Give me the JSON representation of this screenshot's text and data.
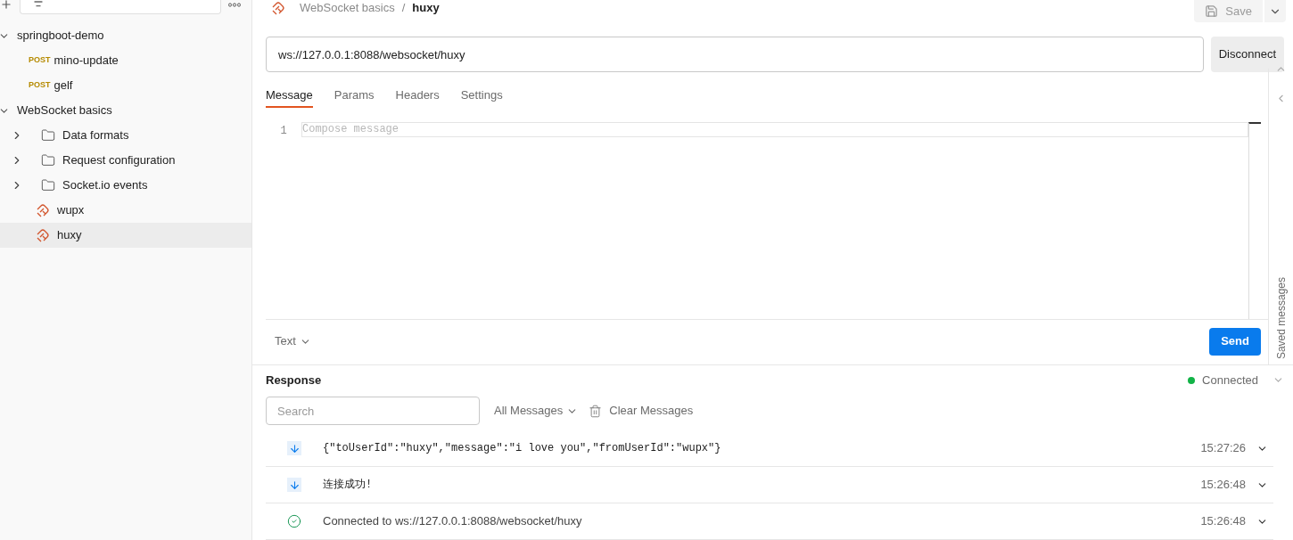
{
  "sidebar": {
    "items": [
      {
        "kind": "collection",
        "label": "springboot-demo",
        "expanded": true,
        "children": [
          {
            "kind": "request",
            "method": "POST",
            "label": "mino-update",
            "selected": false
          },
          {
            "kind": "request",
            "method": "POST",
            "label": "gelf",
            "selected": false
          }
        ]
      },
      {
        "kind": "collection",
        "label": "WebSocket basics",
        "expanded": true,
        "children": [
          {
            "kind": "folder",
            "label": "Data formats",
            "expanded": false
          },
          {
            "kind": "folder",
            "label": "Request configuration",
            "expanded": false
          },
          {
            "kind": "folder",
            "label": "Socket.io events",
            "expanded": false
          },
          {
            "kind": "websocket",
            "label": "wupx",
            "selected": false
          },
          {
            "kind": "websocket",
            "label": "huxy",
            "selected": true
          }
        ]
      }
    ]
  },
  "header": {
    "breadcrumb": [
      "WebSocket basics",
      "/",
      "huxy"
    ],
    "save_label": "Save"
  },
  "url": {
    "value": "ws://127.0.0.1:8088/websocket/huxy"
  },
  "connect_button": "Disconnect",
  "tabs": [
    {
      "label": "Message",
      "selected": true
    },
    {
      "label": "Params",
      "selected": false
    },
    {
      "label": "Headers",
      "selected": false
    },
    {
      "label": "Settings",
      "selected": false
    }
  ],
  "editor": {
    "line_number": "1",
    "placeholder": "Compose message",
    "format": "Text",
    "send_label": "Send"
  },
  "saved_messages_label": "Saved messages",
  "response": {
    "title": "Response",
    "status": "Connected",
    "connected": true,
    "search_placeholder": "Search",
    "filter": "All Messages",
    "clear_label": "Clear Messages",
    "messages": [
      {
        "kind": "incoming",
        "text": "{\"toUserId\":\"huxy\",\"message\":\"i love you\",\"fromUserId\":\"wupx\"}",
        "time": "15:27:26"
      },
      {
        "kind": "incoming",
        "text": "连接成功!",
        "time": "15:26:48"
      },
      {
        "kind": "connected",
        "text": "Connected to ws://127.0.0.1:8088/websocket/huxy",
        "time": "15:26:48"
      }
    ]
  }
}
